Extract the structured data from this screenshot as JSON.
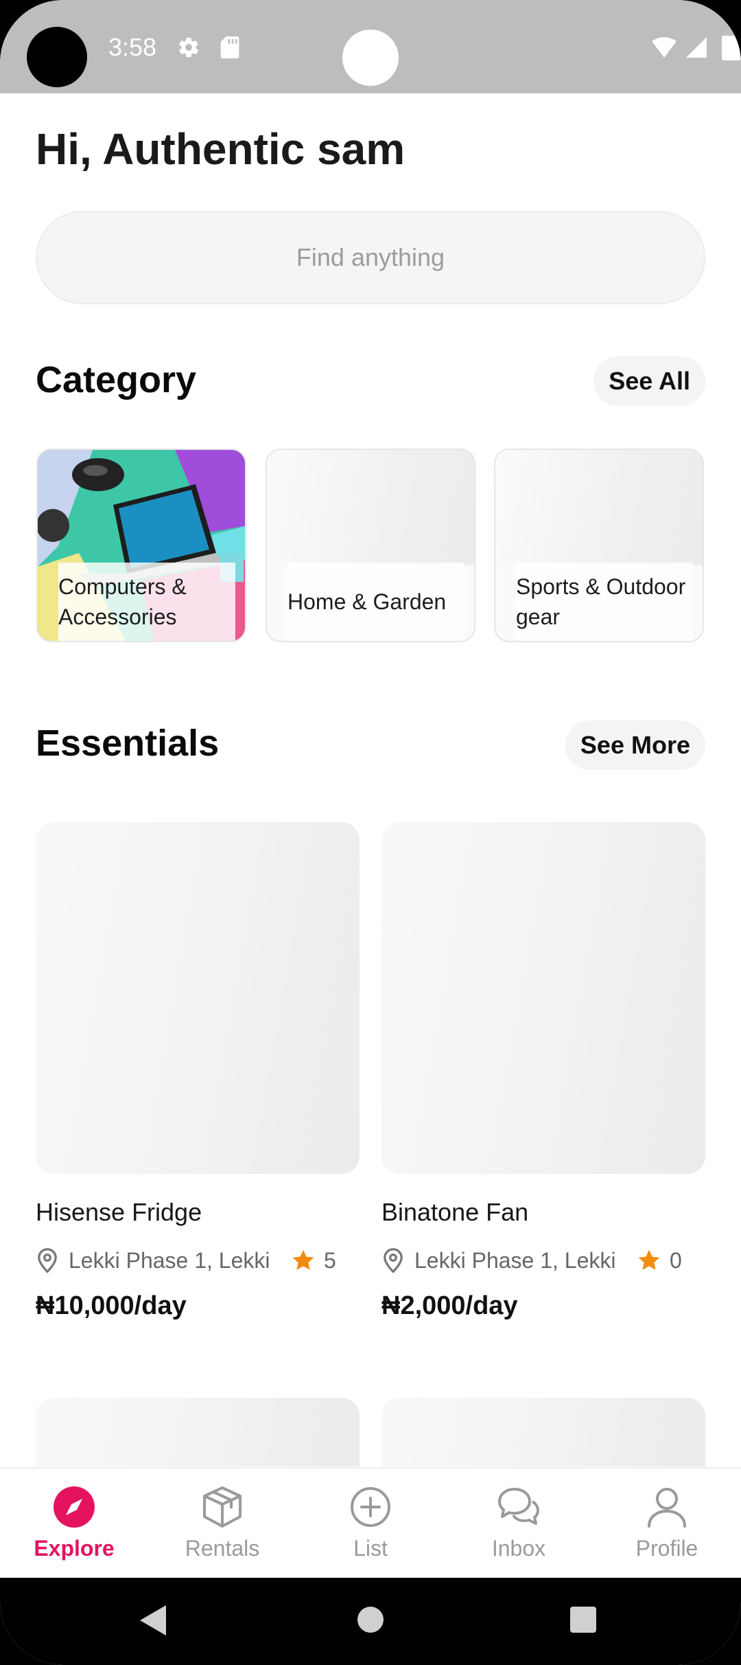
{
  "status_bar": {
    "time": "3:58"
  },
  "greeting": "Hi, Authentic sam",
  "search": {
    "placeholder": "Find anything"
  },
  "category_section": {
    "title": "Category",
    "see_all_label": "See All",
    "items": [
      {
        "label": "Computers & Accessories"
      },
      {
        "label": "Home & Garden"
      },
      {
        "label": "Sports & Outdoor gear"
      }
    ]
  },
  "essentials_section": {
    "title": "Essentials",
    "see_more_label": "See More",
    "products": [
      {
        "name": "Hisense Fridge",
        "location": "Lekki Phase 1, Lekki",
        "rating": "5",
        "price": "₦10,000/day"
      },
      {
        "name": "Binatone Fan",
        "location": "Lekki Phase 1, Lekki",
        "rating": "0",
        "price": "₦2,000/day"
      }
    ]
  },
  "bottom_nav": {
    "items": [
      {
        "label": "Explore",
        "icon": "compass-icon",
        "active": true
      },
      {
        "label": "Rentals",
        "icon": "box-icon",
        "active": false
      },
      {
        "label": "List",
        "icon": "plus-circle-icon",
        "active": false
      },
      {
        "label": "Inbox",
        "icon": "chat-bubbles-icon",
        "active": false
      },
      {
        "label": "Profile",
        "icon": "person-icon",
        "active": false
      }
    ]
  },
  "colors": {
    "accent": "#E5135F",
    "star": "#F28C0F",
    "status_bar": "#BDBDBD"
  }
}
